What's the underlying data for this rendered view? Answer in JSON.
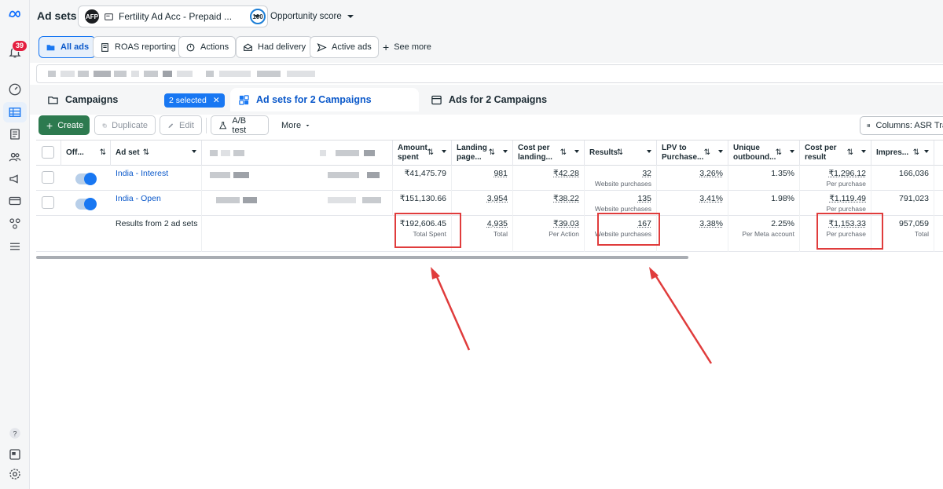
{
  "header": {
    "title": "Ad sets",
    "account_name": "Fertility Ad Acc - Prepaid ...",
    "account_logo": "AFP",
    "score_value": "100",
    "score_label": "Opportunity score"
  },
  "notifications": {
    "count": "39"
  },
  "filters": {
    "all_ads": "All ads",
    "roas": "ROAS reporting",
    "actions": "Actions",
    "had_delivery": "Had delivery",
    "active_ads": "Active ads",
    "see_more": "See more"
  },
  "tabs": {
    "campaigns": "Campaigns",
    "selected_chip": "2 selected",
    "adsets": "Ad sets for 2 Campaigns",
    "ads": "Ads for 2 Campaigns"
  },
  "toolbar": {
    "create": "Create",
    "duplicate": "Duplicate",
    "edit": "Edit",
    "ab_test": "A/B test",
    "more": "More",
    "columns": "Columns: ASR Tra"
  },
  "table": {
    "headers": {
      "offon": "Off...",
      "adset": "Ad set",
      "amount": "Amount spent",
      "landing": "Landing page...",
      "cpl": "Cost per landing...",
      "results": "Results",
      "lpv": "LPV to Purchase...",
      "unique": "Unique outbound...",
      "cpr": "Cost per result",
      "impr": "Impres..."
    },
    "rows": [
      {
        "name": "India - Interest",
        "amount": "₹41,475.79",
        "landing": "981",
        "cpl": "₹42.28",
        "results": "32",
        "results_sub": "Website purchases",
        "lpv": "3.26%",
        "unique": "1.35%",
        "cpr": "₹1,296.12",
        "cpr_sub": "Per purchase",
        "impr": "166,036"
      },
      {
        "name": "India - Open",
        "amount": "₹151,130.66",
        "landing": "3,954",
        "cpl": "₹38.22",
        "results": "135",
        "results_sub": "Website purchases",
        "lpv": "3.41%",
        "unique": "1.98%",
        "cpr": "₹1,119.49",
        "cpr_sub": "Per purchase",
        "impr": "791,023"
      }
    ],
    "summary": {
      "label": "Results from 2 ad sets",
      "amount": "₹192,606.45",
      "amount_sub": "Total Spent",
      "landing": "4,935",
      "landing_sub": "Total",
      "cpl": "₹39.03",
      "cpl_sub": "Per Action",
      "results": "167",
      "results_sub": "Website purchases",
      "lpv": "3.38%",
      "unique": "2.25%",
      "unique_sub": "Per Meta account",
      "cpr": "₹1,153.33",
      "cpr_sub": "Per purchase",
      "impr": "957,059",
      "impr_sub": "Total"
    }
  },
  "colors": {
    "accent": "#1877f2",
    "create": "#2d7a4f",
    "highlight": "#e03c3c"
  }
}
